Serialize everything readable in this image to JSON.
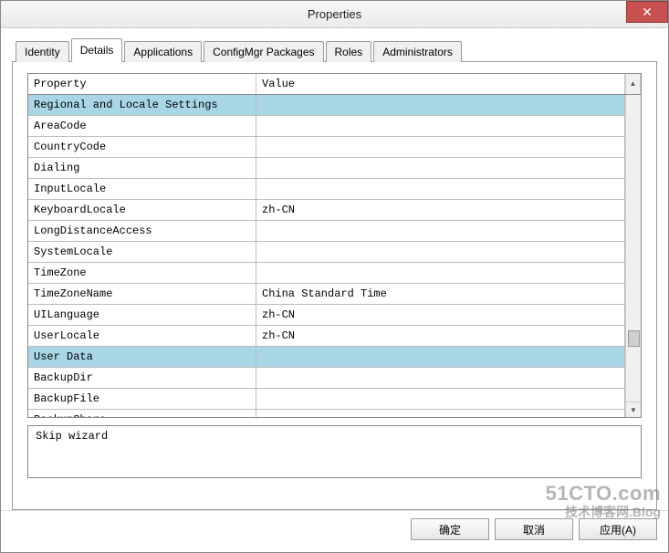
{
  "window": {
    "title": "Properties",
    "close_glyph": "✕"
  },
  "tabs": [
    {
      "label": "Identity",
      "active": false
    },
    {
      "label": "Details",
      "active": true
    },
    {
      "label": "Applications",
      "active": false
    },
    {
      "label": "ConfigMgr Packages",
      "active": false
    },
    {
      "label": "Roles",
      "active": false
    },
    {
      "label": "Administrators",
      "active": false
    }
  ],
  "grid": {
    "headers": {
      "property": "Property",
      "value": "Value"
    },
    "rows": [
      {
        "type": "group",
        "property": "Regional and Locale Settings",
        "value": ""
      },
      {
        "type": "item",
        "property": "AreaCode",
        "value": ""
      },
      {
        "type": "item",
        "property": "CountryCode",
        "value": ""
      },
      {
        "type": "item",
        "property": "Dialing",
        "value": ""
      },
      {
        "type": "item",
        "property": "InputLocale",
        "value": ""
      },
      {
        "type": "item",
        "property": "KeyboardLocale",
        "value": "zh-CN"
      },
      {
        "type": "item",
        "property": "LongDistanceAccess",
        "value": ""
      },
      {
        "type": "item",
        "property": "SystemLocale",
        "value": ""
      },
      {
        "type": "item",
        "property": "TimeZone",
        "value": ""
      },
      {
        "type": "item",
        "property": "TimeZoneName",
        "value": "China Standard Time"
      },
      {
        "type": "item",
        "property": "UILanguage",
        "value": "zh-CN"
      },
      {
        "type": "item",
        "property": "UserLocale",
        "value": "zh-CN"
      },
      {
        "type": "group",
        "property": "User Data",
        "value": ""
      },
      {
        "type": "item",
        "property": "BackupDir",
        "value": ""
      },
      {
        "type": "item",
        "property": "BackupFile",
        "value": ""
      },
      {
        "type": "item",
        "property": "BackupShare",
        "value": ""
      }
    ]
  },
  "description": "Skip wizard",
  "buttons": {
    "ok": "确定",
    "cancel": "取消",
    "apply": "应用(A)"
  },
  "watermark": {
    "line1": "51CTO.com",
    "line2": "技术博客网.Blog"
  }
}
